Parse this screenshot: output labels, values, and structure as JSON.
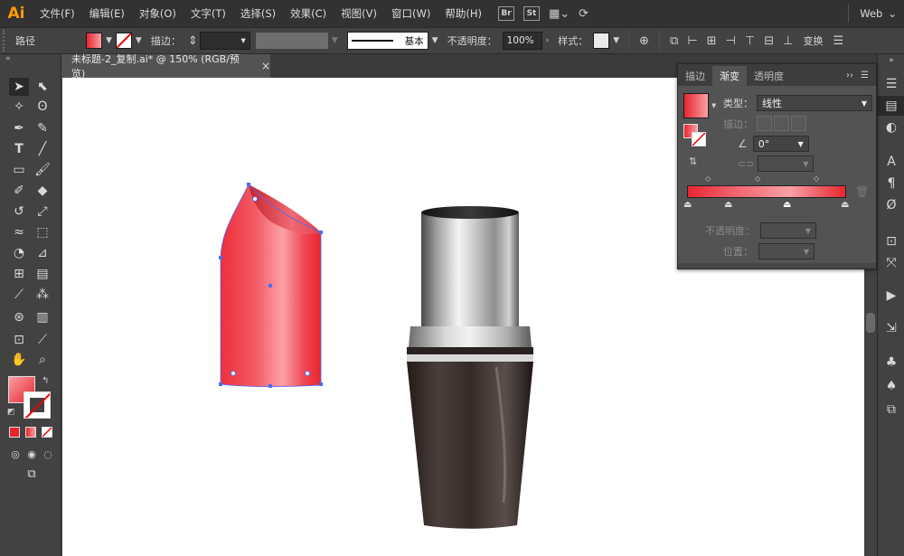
{
  "app": {
    "logo": "Ai"
  },
  "menu": [
    "文件(F)",
    "编辑(E)",
    "对象(O)",
    "文字(T)",
    "选择(S)",
    "效果(C)",
    "视图(V)",
    "窗口(W)",
    "帮助(H)"
  ],
  "menu_badges": [
    "Br",
    "St"
  ],
  "workspace": {
    "label": "Web",
    "arrow": "⌄"
  },
  "control": {
    "object_type": "路径",
    "stroke_label": "描边：",
    "stroke_profile": "基本",
    "opacity_label": "不透明度：",
    "opacity_value": "100%",
    "style_label": "样式：",
    "transform_label": "变换"
  },
  "document_tab": {
    "title": "未标题-2_复制.ai* @ 150% (RGB/预览)",
    "close": "×"
  },
  "gradient_panel": {
    "tabs": [
      "描边",
      "渐变",
      "透明度"
    ],
    "active_tab": "渐变",
    "type_label": "类型：",
    "type_value": "线性",
    "stroke_label": "描边：",
    "angle_value": "0°",
    "opacity_label": "不透明度：",
    "location_label": "位置：",
    "gradient_colors": [
      "#e8252f",
      "#f25b66",
      "#f9a0a6",
      "#e8252f"
    ]
  },
  "colors": {
    "fill_swatch": "#ef4a55",
    "lipstick": "#f25760",
    "tube_dark": "#3a2f2c",
    "silver": "#d9d9d9",
    "selection": "#4b6cf5"
  }
}
